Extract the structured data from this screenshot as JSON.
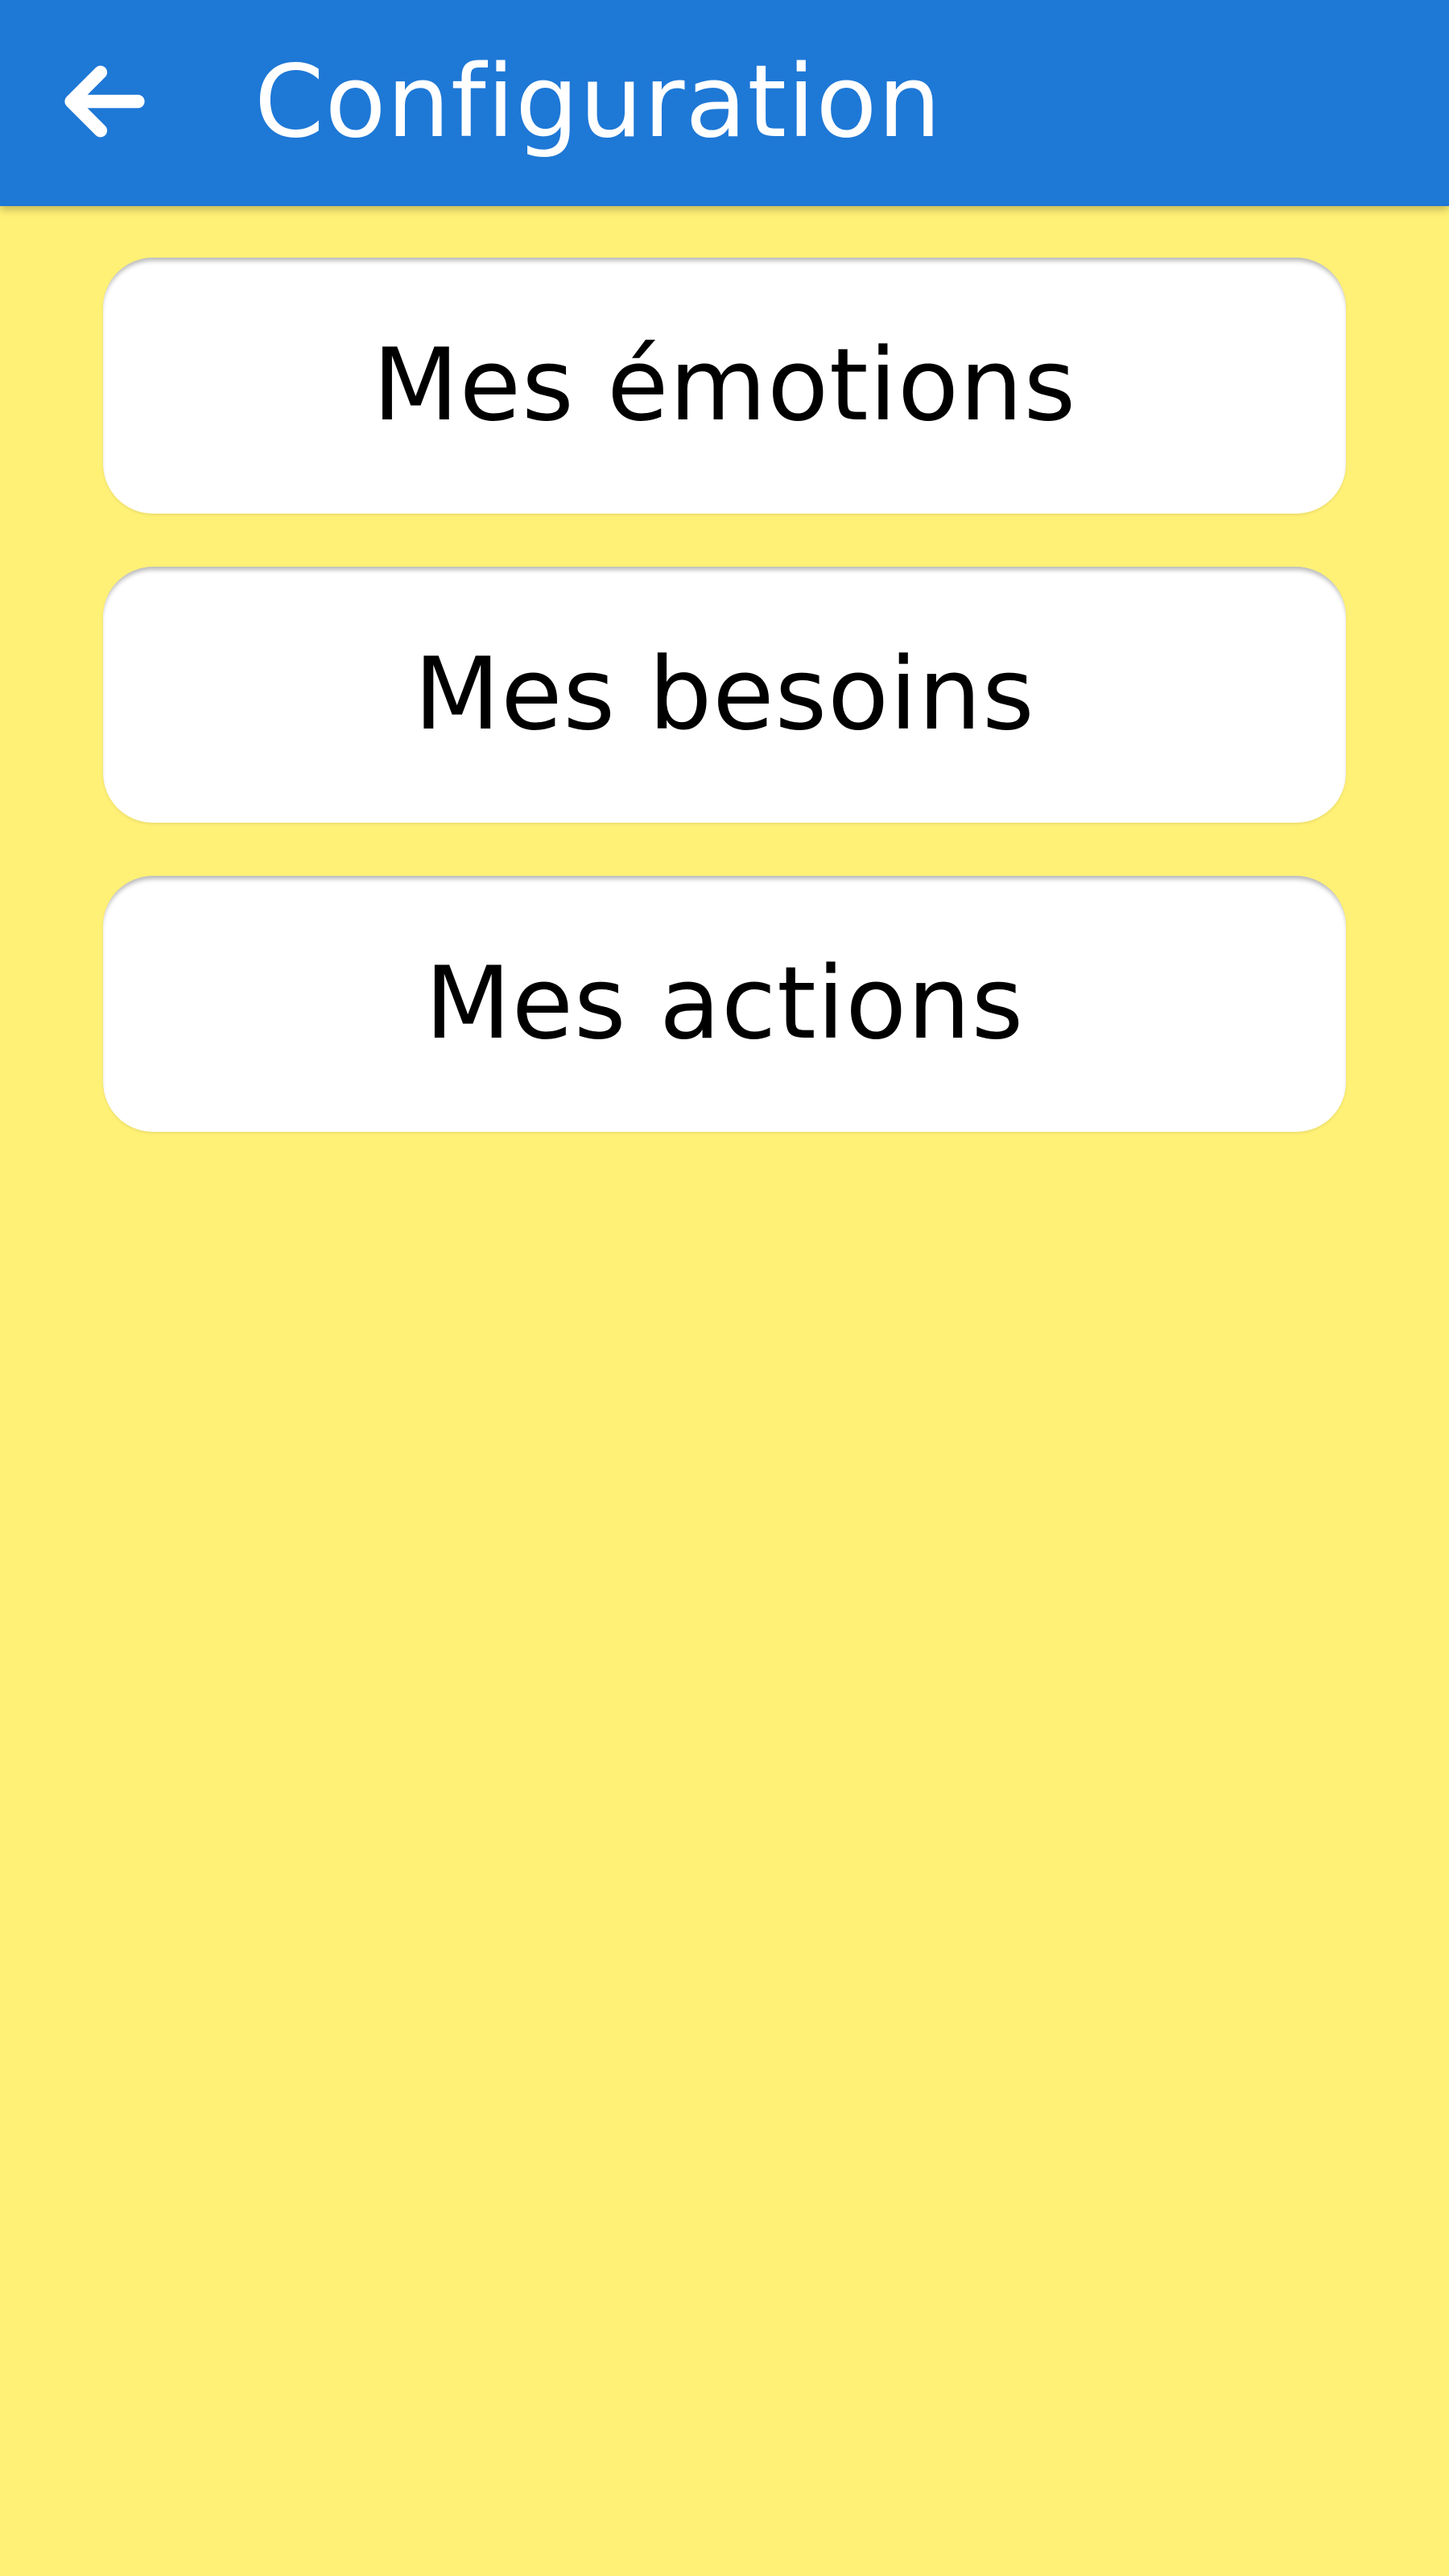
{
  "colors": {
    "app_bar": "#1E78D6",
    "background": "#FFF176",
    "card": "#FFFFFF",
    "title_text": "#FFFFFF",
    "card_text": "#000000"
  },
  "header": {
    "back_icon": "arrow-left-icon",
    "title": "Configuration"
  },
  "menu": {
    "items": [
      {
        "label": "Mes émotions"
      },
      {
        "label": "Mes besoins"
      },
      {
        "label": "Mes actions"
      }
    ]
  }
}
